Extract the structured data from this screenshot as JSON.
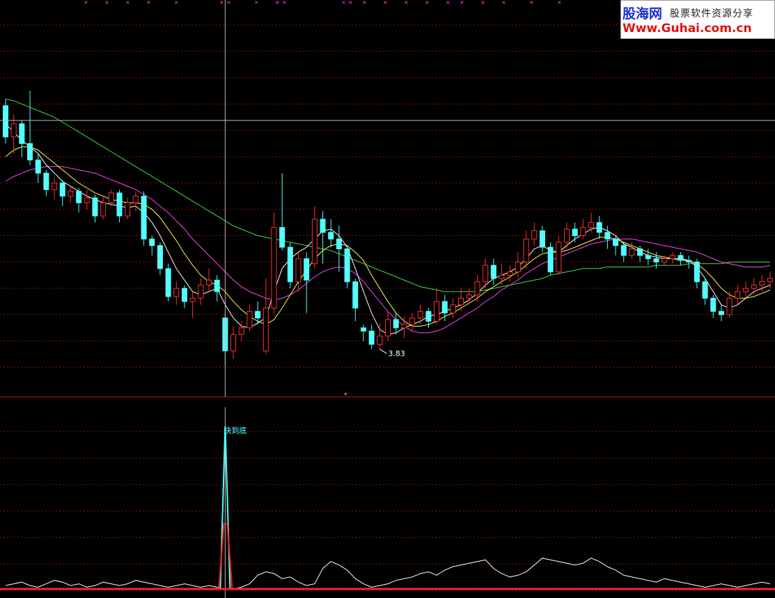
{
  "watermark": {
    "site_name": "股海网",
    "slogan": "股票软件资源分享",
    "url": "Www.Guhai.com.cn"
  },
  "annotations": {
    "low_price_label": "3.83",
    "signal_label": "快到底"
  },
  "colors": {
    "background": "#000000",
    "up_candle": "#ff3030",
    "down_candle": "#54ffff",
    "ma_short": "#ffffff",
    "ma_mid": "#ffff55",
    "ma_long": "#ff44ff",
    "ma_longest": "#44dd44",
    "grid": "#8b1010",
    "signal_bar": "#54ffff",
    "signal_red": "#ff2020",
    "indicator_line": "#ffffff",
    "top_markers": "#ff44ff"
  },
  "chart_data": {
    "type": "candlestick",
    "price_range": [
      3.6,
      5.8
    ],
    "grid": true,
    "low_marker": {
      "index": 46,
      "value": 3.83
    },
    "crosshair_index": 27,
    "candles": [
      [
        5.31,
        5.12,
        5.35,
        5.08
      ],
      [
        5.12,
        5.2,
        5.26,
        5.02
      ],
      [
        5.2,
        5.08,
        5.22,
        5.0
      ],
      [
        5.08,
        4.98,
        5.4,
        4.95
      ],
      [
        4.98,
        4.9,
        5.02,
        4.84
      ],
      [
        4.9,
        4.8,
        4.92,
        4.76
      ],
      [
        4.8,
        4.84,
        4.88,
        4.74
      ],
      [
        4.84,
        4.76,
        4.86,
        4.7
      ],
      [
        4.76,
        4.79,
        4.82,
        4.72
      ],
      [
        4.79,
        4.72,
        4.81,
        4.66
      ],
      [
        4.72,
        4.75,
        4.8,
        4.68
      ],
      [
        4.75,
        4.64,
        4.77,
        4.6
      ],
      [
        4.64,
        4.72,
        4.76,
        4.62
      ],
      [
        4.72,
        4.78,
        4.8,
        4.7
      ],
      [
        4.78,
        4.64,
        4.8,
        4.6
      ],
      [
        4.64,
        4.72,
        4.75,
        4.62
      ],
      [
        4.72,
        4.76,
        4.79,
        4.67
      ],
      [
        4.76,
        4.5,
        4.79,
        4.46
      ],
      [
        4.5,
        4.46,
        4.52,
        4.4
      ],
      [
        4.46,
        4.32,
        4.48,
        4.28
      ],
      [
        4.32,
        4.15,
        4.35,
        4.12
      ],
      [
        4.15,
        4.2,
        4.24,
        4.1
      ],
      [
        4.2,
        4.12,
        4.22,
        4.08
      ],
      [
        4.12,
        4.14,
        4.18,
        4.02
      ],
      [
        4.14,
        4.22,
        4.26,
        4.1
      ],
      [
        4.22,
        4.25,
        4.32,
        4.18
      ],
      [
        4.25,
        4.18,
        4.28,
        4.12
      ],
      [
        4.02,
        3.82,
        4.05,
        3.73
      ],
      [
        3.82,
        3.92,
        3.97,
        3.77
      ],
      [
        3.92,
        3.96,
        4.0,
        3.88
      ],
      [
        3.96,
        4.06,
        4.1,
        3.94
      ],
      [
        4.06,
        4.02,
        4.12,
        3.98
      ],
      [
        3.82,
        4.08,
        4.26,
        3.8
      ],
      [
        4.08,
        4.57,
        4.66,
        4.05
      ],
      [
        4.57,
        4.45,
        4.9,
        4.43
      ],
      [
        4.45,
        4.24,
        4.48,
        4.2
      ],
      [
        4.24,
        4.38,
        4.42,
        4.18
      ],
      [
        4.38,
        4.25,
        4.42,
        4.05
      ],
      [
        4.35,
        4.62,
        4.7,
        4.32
      ],
      [
        4.62,
        4.54,
        4.67,
        4.35
      ],
      [
        4.54,
        4.5,
        4.62,
        4.45
      ],
      [
        4.5,
        4.44,
        4.58,
        4.3
      ],
      [
        4.44,
        4.24,
        4.46,
        4.2
      ],
      [
        4.24,
        4.08,
        4.26,
        4.0
      ],
      [
        3.96,
        3.94,
        3.98,
        3.88
      ],
      [
        3.94,
        3.86,
        3.98,
        3.83
      ],
      [
        3.86,
        3.91,
        3.99,
        3.83
      ],
      [
        3.91,
        4.01,
        4.06,
        3.88
      ],
      [
        4.01,
        3.96,
        4.05,
        3.92
      ],
      [
        3.96,
        3.98,
        4.03,
        3.9
      ],
      [
        3.98,
        4.02,
        4.05,
        3.94
      ],
      [
        4.02,
        4.06,
        4.1,
        3.98
      ],
      [
        4.06,
        4.0,
        4.08,
        3.96
      ],
      [
        4.0,
        4.12,
        4.2,
        3.98
      ],
      [
        4.12,
        4.05,
        4.16,
        4.0
      ],
      [
        4.05,
        4.1,
        4.14,
        4.02
      ],
      [
        4.1,
        4.14,
        4.2,
        4.06
      ],
      [
        4.14,
        4.16,
        4.2,
        4.1
      ],
      [
        4.16,
        4.24,
        4.28,
        4.12
      ],
      [
        4.24,
        4.34,
        4.38,
        4.2
      ],
      [
        4.34,
        4.26,
        4.38,
        4.22
      ],
      [
        4.26,
        4.28,
        4.35,
        4.22
      ],
      [
        4.28,
        4.3,
        4.34,
        4.24
      ],
      [
        4.3,
        4.36,
        4.42,
        4.26
      ],
      [
        4.36,
        4.5,
        4.55,
        4.32
      ],
      [
        4.5,
        4.55,
        4.6,
        4.46
      ],
      [
        4.55,
        4.45,
        4.58,
        4.42
      ],
      [
        4.45,
        4.3,
        4.48,
        4.28
      ],
      [
        4.3,
        4.48,
        4.52,
        4.28
      ],
      [
        4.48,
        4.56,
        4.6,
        4.44
      ],
      [
        4.56,
        4.52,
        4.6,
        4.48
      ],
      [
        4.52,
        4.57,
        4.62,
        4.5
      ],
      [
        4.57,
        4.6,
        4.66,
        4.54
      ],
      [
        4.6,
        4.54,
        4.64,
        4.5
      ],
      [
        4.54,
        4.5,
        4.58,
        4.44
      ],
      [
        4.5,
        4.46,
        4.52,
        4.4
      ],
      [
        4.46,
        4.4,
        4.48,
        4.36
      ],
      [
        4.4,
        4.44,
        4.48,
        4.38
      ],
      [
        4.44,
        4.4,
        4.46,
        4.36
      ],
      [
        4.4,
        4.38,
        4.44,
        4.34
      ],
      [
        4.38,
        4.36,
        4.42,
        4.32
      ],
      [
        4.36,
        4.38,
        4.4,
        4.34
      ],
      [
        4.38,
        4.4,
        4.42,
        4.35
      ],
      [
        4.4,
        4.37,
        4.42,
        4.34
      ],
      [
        4.37,
        4.36,
        4.4,
        4.32
      ],
      [
        4.36,
        4.24,
        4.38,
        4.2
      ],
      [
        4.24,
        4.14,
        4.26,
        4.1
      ],
      [
        4.14,
        4.06,
        4.16,
        4.02
      ],
      [
        4.06,
        4.04,
        4.1,
        4.0
      ],
      [
        4.04,
        4.14,
        4.18,
        4.02
      ],
      [
        4.14,
        4.18,
        4.22,
        4.1
      ],
      [
        4.18,
        4.2,
        4.24,
        4.14
      ],
      [
        4.2,
        4.22,
        4.26,
        4.16
      ],
      [
        4.22,
        4.24,
        4.28,
        4.18
      ],
      [
        4.24,
        4.26,
        4.3,
        4.2
      ]
    ],
    "ma_short": [
      5.2,
      5.15,
      5.1,
      5.06,
      5.02,
      4.95,
      4.9,
      4.85,
      4.82,
      4.79,
      4.76,
      4.74,
      4.72,
      4.71,
      4.7,
      4.69,
      4.7,
      4.66,
      4.6,
      4.52,
      4.42,
      4.32,
      4.25,
      4.18,
      4.16,
      4.18,
      4.2,
      4.1,
      4.02,
      3.97,
      3.96,
      3.99,
      4.02,
      4.18,
      4.32,
      4.38,
      4.42,
      4.45,
      4.5,
      4.55,
      4.56,
      4.52,
      4.45,
      4.32,
      4.18,
      4.05,
      3.95,
      3.92,
      3.93,
      3.96,
      3.98,
      4.0,
      4.03,
      4.04,
      4.06,
      4.08,
      4.1,
      4.13,
      4.17,
      4.22,
      4.26,
      4.28,
      4.3,
      4.33,
      4.38,
      4.44,
      4.46,
      4.43,
      4.42,
      4.46,
      4.5,
      4.53,
      4.56,
      4.57,
      4.55,
      4.52,
      4.47,
      4.45,
      4.42,
      4.4,
      4.39,
      4.38,
      4.38,
      4.38,
      4.37,
      4.33,
      4.26,
      4.18,
      4.1,
      4.08,
      4.1,
      4.14,
      4.18,
      4.2,
      4.22
    ],
    "ma_mid": [
      5.0,
      5.04,
      5.06,
      5.06,
      5.04,
      5.0,
      4.96,
      4.92,
      4.88,
      4.84,
      4.81,
      4.78,
      4.76,
      4.74,
      4.73,
      4.72,
      4.72,
      4.71,
      4.68,
      4.63,
      4.56,
      4.49,
      4.41,
      4.34,
      4.28,
      4.24,
      4.22,
      4.18,
      4.12,
      4.07,
      4.03,
      4.0,
      3.98,
      4.01,
      4.08,
      4.16,
      4.24,
      4.31,
      4.38,
      4.43,
      4.46,
      4.47,
      4.46,
      4.42,
      4.37,
      4.28,
      4.2,
      4.12,
      4.05,
      4.0,
      3.97,
      3.97,
      3.98,
      4.0,
      4.03,
      4.05,
      4.08,
      4.11,
      4.14,
      4.18,
      4.21,
      4.24,
      4.27,
      4.3,
      4.34,
      4.38,
      4.41,
      4.42,
      4.42,
      4.43,
      4.45,
      4.47,
      4.49,
      4.51,
      4.51,
      4.5,
      4.48,
      4.46,
      4.44,
      4.42,
      4.4,
      4.39,
      4.38,
      4.37,
      4.37,
      4.35,
      4.31,
      4.26,
      4.2,
      4.16,
      4.14,
      4.14,
      4.15,
      4.17,
      4.19
    ],
    "ma_long": [
      4.85,
      4.88,
      4.9,
      4.92,
      4.93,
      4.94,
      4.94,
      4.94,
      4.93,
      4.92,
      4.91,
      4.9,
      4.88,
      4.86,
      4.84,
      4.82,
      4.8,
      4.77,
      4.74,
      4.7,
      4.66,
      4.61,
      4.56,
      4.5,
      4.45,
      4.4,
      4.35,
      4.3,
      4.25,
      4.21,
      4.18,
      4.16,
      4.14,
      4.13,
      4.14,
      4.16,
      4.19,
      4.23,
      4.27,
      4.3,
      4.32,
      4.33,
      4.32,
      4.29,
      4.24,
      4.18,
      4.12,
      4.06,
      4.01,
      3.97,
      3.94,
      3.93,
      3.93,
      3.94,
      3.96,
      3.99,
      4.02,
      4.05,
      4.08,
      4.12,
      4.15,
      4.19,
      4.22,
      4.25,
      4.29,
      4.32,
      4.35,
      4.37,
      4.39,
      4.41,
      4.43,
      4.45,
      4.47,
      4.48,
      4.49,
      4.5,
      4.5,
      4.5,
      4.49,
      4.48,
      4.47,
      4.46,
      4.45,
      4.44,
      4.43,
      4.42,
      4.4,
      4.38,
      4.36,
      4.35,
      4.34,
      4.33,
      4.33,
      4.33,
      4.34
    ],
    "ma_longest": [
      5.35,
      5.34,
      5.32,
      5.3,
      5.28,
      5.26,
      5.24,
      5.21,
      5.18,
      5.15,
      5.12,
      5.09,
      5.06,
      5.03,
      5.0,
      4.97,
      4.94,
      4.91,
      4.88,
      4.85,
      4.82,
      4.79,
      4.76,
      4.73,
      4.7,
      4.67,
      4.64,
      4.61,
      4.58,
      4.56,
      4.54,
      4.52,
      4.51,
      4.5,
      4.49,
      4.48,
      4.47,
      4.46,
      4.45,
      4.44,
      4.43,
      4.41,
      4.39,
      4.37,
      4.35,
      4.33,
      4.31,
      4.29,
      4.27,
      4.25,
      4.23,
      4.21,
      4.2,
      4.19,
      4.18,
      4.18,
      4.18,
      4.18,
      4.18,
      4.19,
      4.2,
      4.21,
      4.22,
      4.23,
      4.24,
      4.25,
      4.26,
      4.28,
      4.29,
      4.3,
      4.31,
      4.32,
      4.32,
      4.32,
      4.33,
      4.33,
      4.33,
      4.33,
      4.33,
      4.33,
      4.34,
      4.34,
      4.34,
      4.34,
      4.35,
      4.35,
      4.35,
      4.35,
      4.35,
      4.36,
      4.36,
      4.36,
      4.36,
      4.36,
      4.36
    ],
    "indicator": {
      "range": [
        0,
        100
      ],
      "signal_index": 27,
      "signal_value": 95,
      "signal_red_value": 38,
      "line": [
        2,
        3,
        4,
        2,
        1,
        3,
        5,
        4,
        2,
        3,
        1,
        2,
        4,
        3,
        2,
        3,
        5,
        4,
        3,
        2,
        1,
        2,
        3,
        2,
        1,
        2,
        1,
        0,
        0,
        1,
        3,
        8,
        10,
        9,
        6,
        7,
        4,
        2,
        3,
        12,
        16,
        14,
        11,
        6,
        3,
        1,
        2,
        3,
        5,
        6,
        7,
        9,
        10,
        8,
        11,
        13,
        14,
        15,
        16,
        17,
        12,
        9,
        7,
        8,
        10,
        14,
        18,
        17,
        16,
        15,
        14,
        15,
        18,
        16,
        13,
        11,
        8,
        7,
        6,
        5,
        4,
        6,
        5,
        4,
        3,
        2,
        1,
        2,
        3,
        2,
        1,
        2,
        3,
        4,
        3
      ]
    }
  }
}
